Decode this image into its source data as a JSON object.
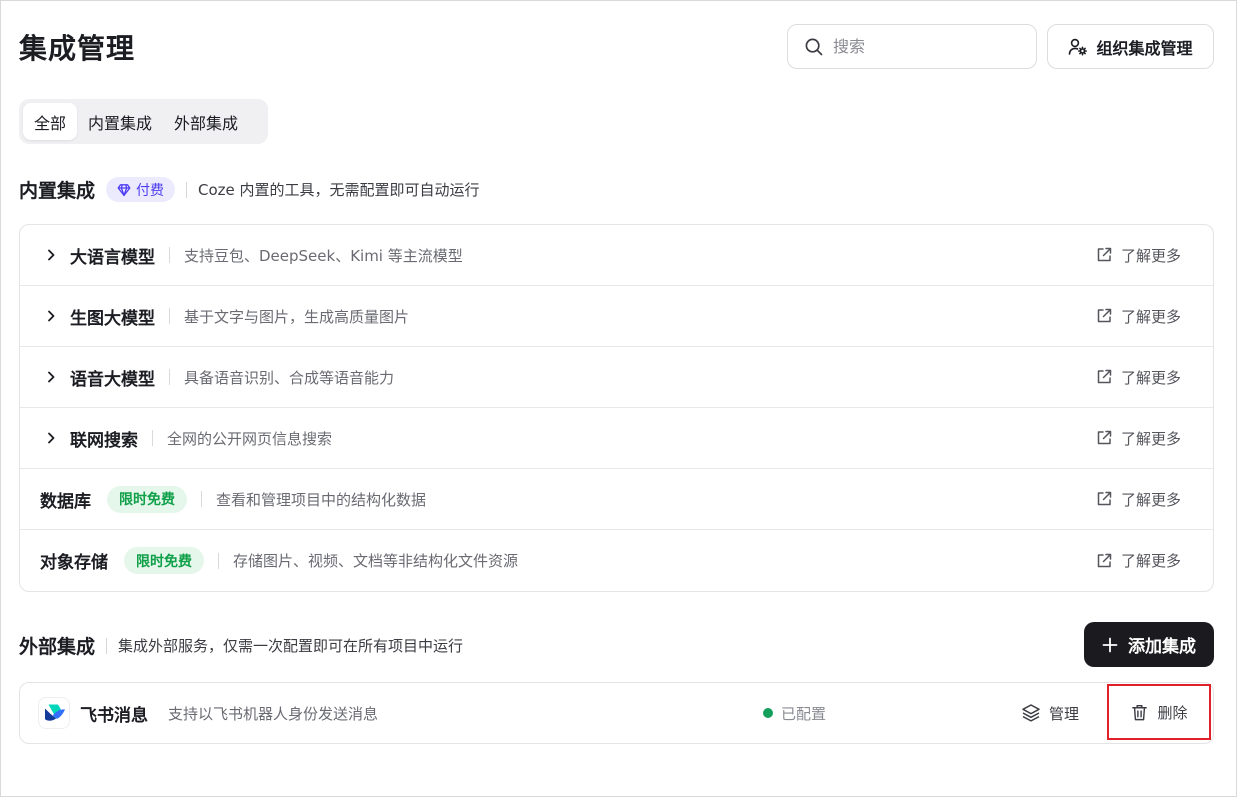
{
  "header": {
    "title": "集成管理",
    "search_placeholder": "搜索",
    "org_button_label": "组织集成管理"
  },
  "tabs": [
    {
      "label": "全部",
      "active": true
    },
    {
      "label": "内置集成",
      "active": false
    },
    {
      "label": "外部集成",
      "active": false
    }
  ],
  "builtin": {
    "title": "内置集成",
    "badge": "付费",
    "description": "Coze 内置的工具，无需配置即可自动运行",
    "learn_more_label": "了解更多",
    "items": [
      {
        "name": "大语言模型",
        "desc": "支持豆包、DeepSeek、Kimi 等主流模型",
        "expandable": true
      },
      {
        "name": "生图大模型",
        "desc": "基于文字与图片，生成高质量图片",
        "expandable": true
      },
      {
        "name": "语音大模型",
        "desc": "具备语音识别、合成等语音能力",
        "expandable": true
      },
      {
        "name": "联网搜索",
        "desc": "全网的公开网页信息搜索",
        "expandable": true
      },
      {
        "name": "数据库",
        "badge": "限时免费",
        "desc": "查看和管理项目中的结构化数据",
        "expandable": false
      },
      {
        "name": "对象存储",
        "badge": "限时免费",
        "desc": "存储图片、视频、文档等非结构化文件资源",
        "expandable": false
      }
    ]
  },
  "external": {
    "title": "外部集成",
    "description": "集成外部服务，仅需一次配置即可在所有项目中运行",
    "add_button_label": "添加集成",
    "items": [
      {
        "name": "飞书消息",
        "desc": "支持以飞书机器人身份发送消息",
        "status": "已配置",
        "manage_label": "管理",
        "delete_label": "删除",
        "icon": "feishu-logo"
      }
    ]
  },
  "colors": {
    "accent_purple": "#4d3df0",
    "free_green": "#11a04a",
    "status_green": "#14a05a",
    "highlight_red": "#e0202a",
    "primary_button": "#1b1b1f"
  }
}
